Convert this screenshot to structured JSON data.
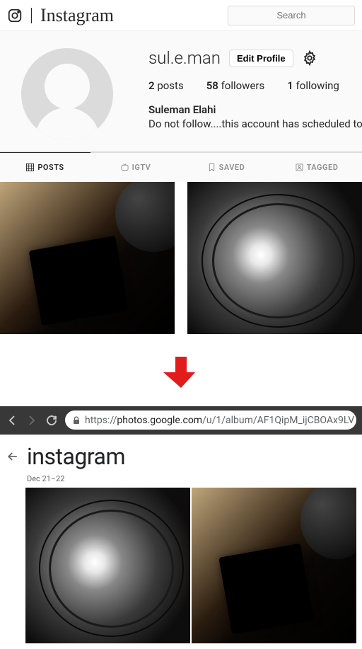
{
  "instagram": {
    "header": {
      "wordmark": "Instagram",
      "search_placeholder": "Search"
    },
    "profile": {
      "username": "sul.e.man",
      "edit_label": "Edit Profile",
      "posts_count": "2",
      "posts_label": "posts",
      "followers_count": "58",
      "followers_label": "followers",
      "following_count": "1",
      "following_label": "following",
      "fullname": "Suleman Elahi",
      "bio": "Do not follow....this account has scheduled to be p"
    },
    "tabs": {
      "posts": "POSTS",
      "igtv": "IGTV",
      "saved": "SAVED",
      "tagged": "TAGGED"
    }
  },
  "browser": {
    "url_scheme": "https://",
    "url_host": "photos.google.com",
    "url_path": "/u/1/album/AF1QipM_ijCBOAx9LV"
  },
  "google_photos": {
    "title": "instagram",
    "date_range": "Dec 21–22"
  }
}
